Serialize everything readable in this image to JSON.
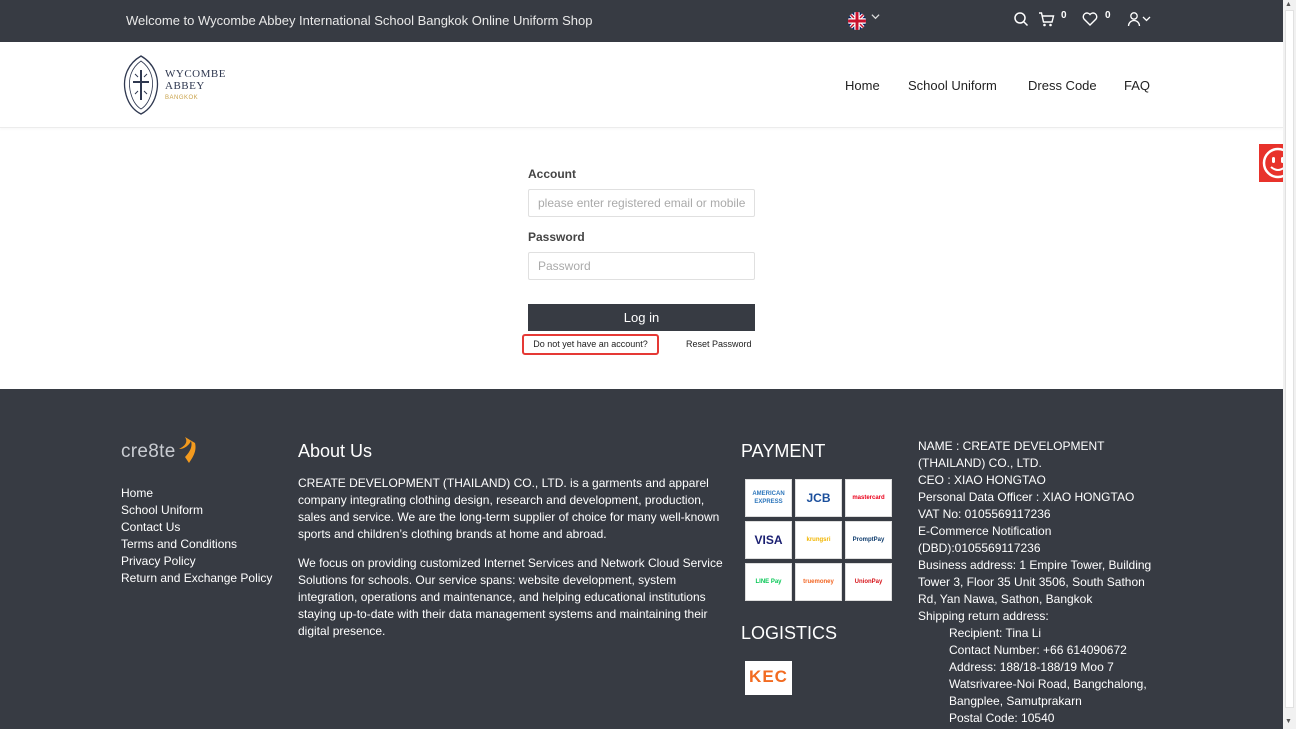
{
  "topbar": {
    "welcome": "Welcome to Wycombe Abbey International School Bangkok Online Uniform Shop",
    "cart_count": "0",
    "wishlist_count": "0"
  },
  "logo": {
    "line1": "WYCOMBE",
    "line2": "ABBEY",
    "line3": "BANGKOK"
  },
  "nav": {
    "items": [
      "Home",
      "School Uniform",
      "Dress Code",
      "FAQ"
    ]
  },
  "login": {
    "account_label": "Account",
    "account_placeholder": "please enter registered email or mobile",
    "password_label": "Password",
    "password_placeholder": "Password",
    "login_button": "Log in",
    "signup_link": "Do not yet have an account?",
    "reset_link": "Reset Password"
  },
  "footer": {
    "brand": "cre8te",
    "links": [
      "Home",
      "School Uniform",
      "Contact Us",
      "Terms and Conditions",
      "Privacy Policy",
      "Return and Exchange Policy"
    ],
    "about_title": "About Us",
    "about_p1": "CREATE  DEVELOPMENT (THAILAND) CO., LTD.  is a garments and apparel company integrating clothing design, research and development, production, sales and service. We are the long-term supplier of choice for many well-known sports and children’s clothing brands at home and abroad.",
    "about_p2": "We focus on providing customized Internet Services and Network Cloud Service Solutions for schools. Our service spans: website development, system integration, operations and maintenance, and helping educational institutions staying up-to-date with their data management systems and maintaining their digital presence.",
    "payment_title": "PAYMENT",
    "payment_methods": [
      {
        "name": "AMERICAN EXPRESS",
        "color": "#2e77bc"
      },
      {
        "name": "JCB",
        "color": "#1b4f9c"
      },
      {
        "name": "mastercard",
        "color": "#eb001b"
      },
      {
        "name": "VISA",
        "color": "#1a1f71"
      },
      {
        "name": "krungsri",
        "color": "#f2b600"
      },
      {
        "name": "PromptPay",
        "color": "#103d6e"
      },
      {
        "name": "LINE Pay",
        "color": "#06c755"
      },
      {
        "name": "truemoney",
        "color": "#f26522"
      },
      {
        "name": "UnionPay",
        "color": "#d7141a"
      }
    ],
    "logistics_title": "LOGISTICS",
    "logistics_name": "KEC",
    "company_lines": [
      "NAME : CREATE DEVELOPMENT (THAILAND) CO., LTD.",
      "CEO : XIAO HONGTAO",
      "Personal Data Officer : XIAO HONGTAO",
      "VAT No: 0105569117236",
      "E-Commerce Notification (DBD):0105569117236",
      "Business address: 1 Empire Tower, Building Tower 3, Floor 35 Unit 3506, South Sathon Rd, Yan Nawa, Sathon, Bangkok",
      "Shipping return address:"
    ],
    "return_lines": [
      "Recipient: Tina Li",
      "Contact Number: +66 614090672",
      "Address: 188/18-188/19 Moo 7 Watsrivaree-Noi Road, Bangchalong, Bangplee, Samutprakarn",
      "Postal Code: 10540"
    ]
  },
  "colors": {
    "dark_bar": "#373b43",
    "highlight_border": "#e53935",
    "feedback_tab": "#e8322b",
    "logo_gold": "#c9a24a"
  }
}
